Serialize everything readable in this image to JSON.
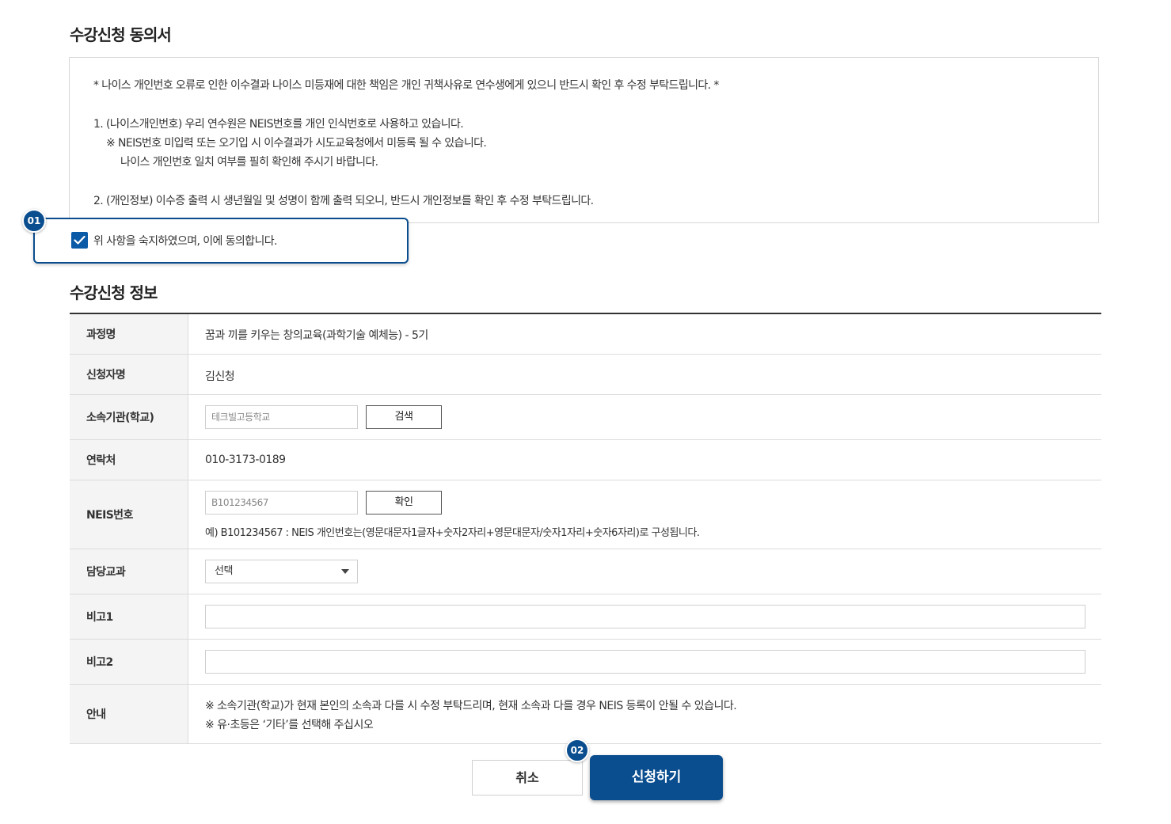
{
  "consent": {
    "title": "수강신청 동의서",
    "notice": "* 나이스 개인번호 오류로 인한 이수결과 나이스 미등재에 대한 책임은 개인 귀책사유로 연수생에게 있으니 반드시 확인 후 수정 부탁드립니다. *",
    "item1": "1. (나이스개인번호) 우리 연수원은 NEIS번호를 개인 인식번호로 사용하고 있습니다.",
    "item1_note1": "※ NEIS번호 미입력 또는 오기입 시 이수결과가 시도교육청에서 미등록 될 수 있습니다.",
    "item1_note2": "나이스 개인번호 일치 여부를 필히 확인해 주시기 바랍니다.",
    "item2": "2. (개인정보) 이수증 출력 시 생년월일 및 성명이 함께 출력 되오니, 반드시 개인정보를 확인 후 수정 부탁드립니다.",
    "agree_label": "위 사항을 숙지하였으며, 이에 동의합니다.",
    "agree_checked": true,
    "badge": "01"
  },
  "info": {
    "title": "수강신청 정보",
    "course": {
      "label": "과정명",
      "value": "꿈과 끼를 키우는 창의교육(과학기술 예체능) - 5기"
    },
    "applicant": {
      "label": "신청자명",
      "value": "김신청"
    },
    "school": {
      "label": "소속기관(학교)",
      "placeholder": "테크빌고등학교",
      "button": "검색"
    },
    "contact": {
      "label": "연락처",
      "value": "010-3173-0189"
    },
    "neis": {
      "label": "NEIS번호",
      "placeholder": "B101234567",
      "button": "확인",
      "help": "예) B101234567 : NEIS 개인번호는(영문대문자1글자+숫자2자리+영문대문자/숫자1자리+숫자6자리)로 구성됩니다."
    },
    "subject": {
      "label": "담당교과",
      "selected": "선택"
    },
    "note1": {
      "label": "비고1",
      "value": ""
    },
    "note2": {
      "label": "비고2",
      "value": ""
    },
    "guide": {
      "label": "안내",
      "line1": "※ 소속기관(학교)가 현재 본인의 소속과 다를 시 수정 부탁드리며, 현재 소속과 다를 경우 NEIS 등록이 안될 수 있습니다.",
      "line2": "※ 유·초등은 ‘기타’를 선택해 주십시오"
    }
  },
  "actions": {
    "cancel": "취소",
    "apply": "신청하기",
    "badge": "02"
  },
  "colors": {
    "accent": "#0b4e8f",
    "checkbox": "#0b5aa7"
  }
}
